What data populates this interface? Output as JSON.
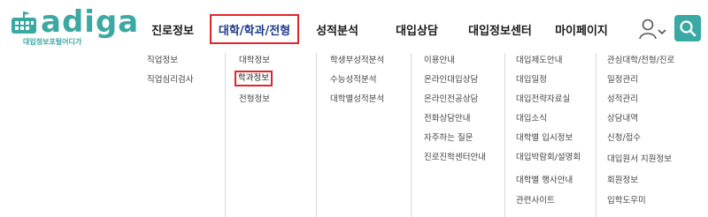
{
  "logo": {
    "word": "adiga",
    "sub": "대입정보포털어디가"
  },
  "nav": [
    {
      "label": "진로정보",
      "active": false
    },
    {
      "label": "대학/학과/전형",
      "active": true
    },
    {
      "label": "성적분석",
      "active": false
    },
    {
      "label": "대입상담",
      "active": false
    },
    {
      "label": "대입정보센터",
      "active": false
    },
    {
      "label": "마이페이지",
      "active": false
    }
  ],
  "utility": {
    "user_icon": "user-icon",
    "search_icon": "search-icon",
    "accent": "#3aa8a3",
    "highlight": "#e0252b"
  },
  "submenu": [
    [
      "직업정보",
      "직업심리검사"
    ],
    [
      "대학정보",
      "학과정보",
      "전형정보"
    ],
    [
      "학생부성적분석",
      "수능성적분석",
      "대학별성적분석"
    ],
    [
      "이용안내",
      "온라인대입상담",
      "온라인전공상담",
      "전화상담안내",
      "자주하는 질문",
      "진로진학센터안내"
    ],
    [
      "대입제도안내",
      "대입일정",
      "대입전략자료실",
      "대입소식",
      "대학별 입시정보",
      "대입박람회/설명회",
      "대학별 행사안내",
      "관련사이트"
    ],
    [
      "관심대학/전형/진로",
      "일정관리",
      "성적관리",
      "상담내역",
      "신청/접수",
      "대입원서 지원정보",
      "회원정보",
      "입학도우미"
    ]
  ]
}
